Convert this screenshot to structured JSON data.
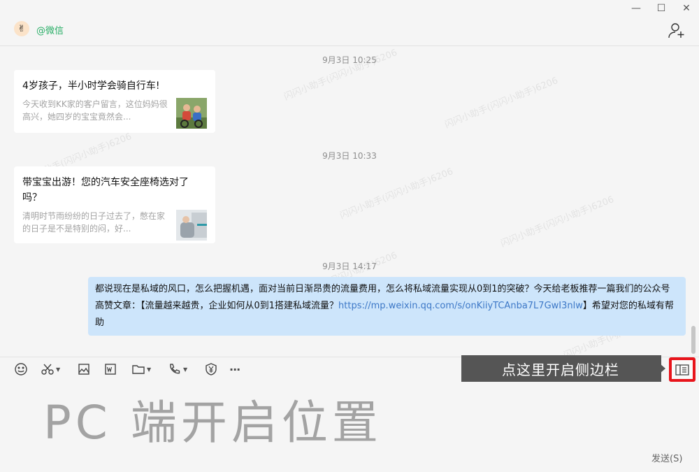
{
  "window": {
    "minimize": "—",
    "maximize": "☐",
    "close": "✕"
  },
  "chat_header": {
    "title": "@微信"
  },
  "messages": [
    {
      "timestamp": "9月3日 10:25",
      "card_title": "4岁孩子，半小时学会骑自行车!",
      "card_desc": "今天收到KK家的客户留言，这位妈妈很高兴，她四岁的宝宝竟然会..."
    },
    {
      "timestamp": "9月3日 10:33",
      "card_title": "带宝宝出游！您的汽车安全座椅选对了吗？",
      "card_desc": "清明时节雨纷纷的日子过去了，憋在家的日子是不是特别的闷，好..."
    },
    {
      "timestamp": "9月3日 14:17",
      "text_before_link": "都说现在是私域的风口，怎么把握机遇，面对当前日渐昂贵的流量费用，怎么将私域流量实现从0到1的突破？今天给老板推荐一篇我们的公众号高赞文章：【流量越来越贵，企业如何从0到1搭建私域流量？",
      "link": "https://mp.weixin.qq.com/s/onKiiyTCAnba7L7GwI3nlw",
      "text_after_link": "】希望对您的私域有帮助"
    }
  ],
  "watermark_text": "闪闪小助手(闪闪小助手)6206",
  "toolbar": {
    "more": "···",
    "tooltip": "点这里开启侧边栏"
  },
  "overlay_caption": "PC 端开启位置",
  "send_button": "发送(S)",
  "colors": {
    "background": "#f5f5f5",
    "bubble": "#cde5fb",
    "link": "#3d78c7",
    "highlight": "#e8141b",
    "tooltip": "#555555",
    "title_green": "#2aae67"
  }
}
